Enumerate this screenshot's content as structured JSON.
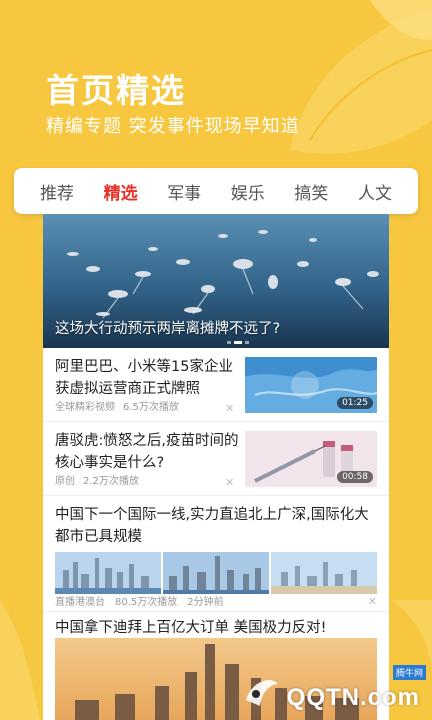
{
  "header": {
    "title": "首页精选",
    "subtitle": "精编专题  突发事件现场早知道"
  },
  "tabs": [
    {
      "label": "推荐",
      "active": false
    },
    {
      "label": "精选",
      "active": true
    },
    {
      "label": "军事",
      "active": false
    },
    {
      "label": "娱乐",
      "active": false
    },
    {
      "label": "搞笑",
      "active": false
    },
    {
      "label": "人文",
      "active": false
    }
  ],
  "hero": {
    "caption": "这场大行动预示两岸离摊牌不远了?"
  },
  "news": [
    {
      "title": "阿里巴巴、小米等15家企业获虚拟运营商正式牌照",
      "source": "全球精彩视频",
      "plays": "6.5万次播放",
      "duration": "01:25",
      "thumb_icon": "world-map-image"
    },
    {
      "title": "唐驳虎:愤怒之后,疫苗时间的核心事实是什么?",
      "source": "原创",
      "plays": "2.2万次播放",
      "duration": "00:58",
      "thumb_icon": "vaccine-syringe-image"
    }
  ],
  "multi": {
    "title": "中国下一个国际一线,实力直追北上广深,国际化大都市已具规模",
    "source": "直播港澳台",
    "plays": "80.5万次播放",
    "time": "2分钟前"
  },
  "last": {
    "title": "中国拿下迪拜上百亿大订单 美国极力反对!"
  },
  "watermark": {
    "brand": "QQTN.com",
    "tag": "腾牛网"
  },
  "colors": {
    "background": "#f7c740",
    "accent": "#e8322a"
  }
}
